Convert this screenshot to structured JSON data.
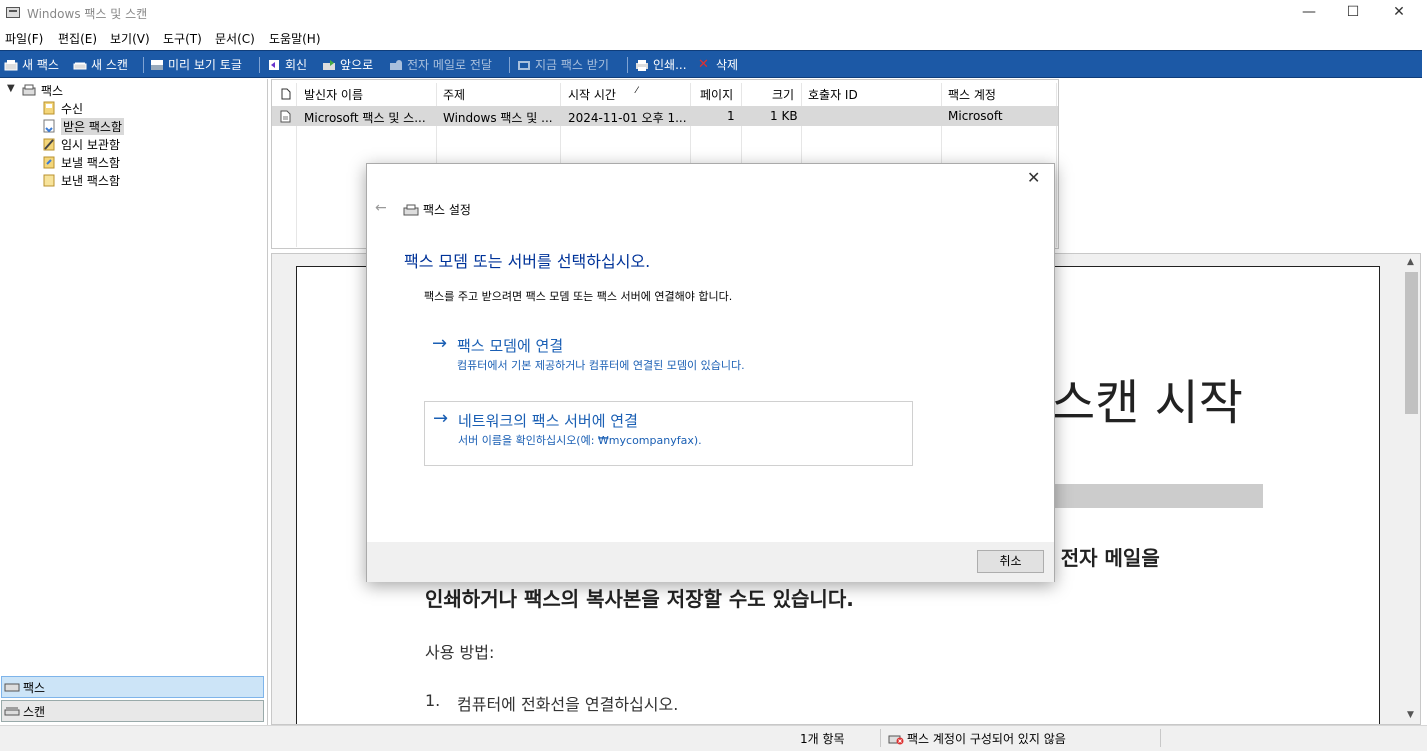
{
  "window": {
    "title": "Windows 팩스 및 스캔",
    "min_glyph": "—",
    "max_glyph": "☐",
    "close_glyph": "✕"
  },
  "menu": [
    "파일(F)",
    "편집(E)",
    "보기(V)",
    "도구(T)",
    "문서(C)",
    "도움말(H)"
  ],
  "toolbar": {
    "new_fax": "새 팩스",
    "new_scan": "새 스캔",
    "preview": "미리 보기 토글",
    "reply": "회신",
    "forward": "앞으로",
    "email_forward": "전자 메일로 전달",
    "receive_now": "지금 팩스 받기",
    "print": "인쇄...",
    "delete": "삭제"
  },
  "tree": {
    "root": "팩스",
    "items": [
      "수신",
      "받은 팩스함",
      "임시 보관함",
      "보낼 팩스함",
      "보낸 팩스함"
    ],
    "selected": "받은 팩스함"
  },
  "nav_buttons": {
    "fax": "팩스",
    "scan": "스캔"
  },
  "list": {
    "columns": [
      "발신자 이름",
      "주제",
      "시작 시간",
      "페이지",
      "크기",
      "호출자 ID",
      "팩스 계정"
    ],
    "sort_indicator": "⁄",
    "rows": [
      {
        "sender": "Microsoft 팩스 및 스...",
        "subject": "Windows 팩스 및 ...",
        "start_time": "2024-11-01 오후 1...",
        "pages": "1",
        "size": "1 KB",
        "caller_id": "",
        "account": "Microsoft"
      }
    ]
  },
  "preview": {
    "title_fragment": "스캔 시작",
    "line1_fragment": "또한 전자 메일을",
    "line2": "인쇄하거나 팩스의 복사본을 저장할 수도 있습니다.",
    "usage": "사용 방법:",
    "step_num": "1.",
    "step1": "컴퓨터에 전화선을 연결하십시오."
  },
  "status": {
    "count": "1개 항목",
    "message": "팩스 계정이 구성되어 있지 않음"
  },
  "dialog": {
    "back_glyph": "←",
    "close_glyph": "✕",
    "header": "팩스 설정",
    "heading": "팩스 모뎀 또는 서버를 선택하십시오.",
    "description": "팩스를 주고 받으려면 팩스 모뎀 또는 팩스 서버에 연결해야 합니다.",
    "option1": {
      "arrow": "→",
      "title": "팩스 모뎀에 연결",
      "subtitle": "컴퓨터에서 기본 제공하거나 컴퓨터에 연결된 모뎀이 있습니다."
    },
    "option2": {
      "arrow": "→",
      "title": "네트워크의 팩스 서버에 연결",
      "subtitle": "서버 이름을 확인하십시오(예: ₩mycompanyfax)."
    },
    "cancel": "취소"
  },
  "colors": {
    "toolbar": "#1c59a6",
    "link": "#1a5fb4",
    "heading": "#003399",
    "selection": "#d9d9d9"
  }
}
